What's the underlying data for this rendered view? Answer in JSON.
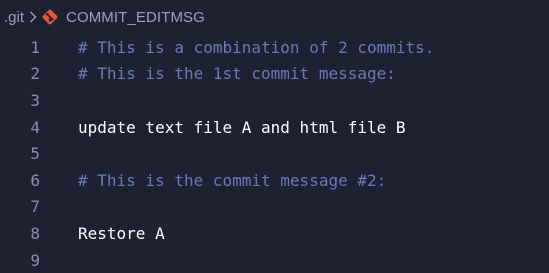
{
  "breadcrumb": {
    "folder": ".git",
    "separator_icon": "chevron-right-icon",
    "file_icon": "git-icon",
    "file": "COMMIT_EDITMSG"
  },
  "colors": {
    "background": "#1e2132",
    "comment": "#6b79b8",
    "text": "#ffffff",
    "line_number": "#8a8fa6",
    "git_icon": "#e8553a"
  },
  "editor": {
    "lines": [
      {
        "number": "1",
        "text": "# This is a combination of 2 commits.",
        "comment": true
      },
      {
        "number": "2",
        "text": "# This is the 1st commit message:",
        "comment": true
      },
      {
        "number": "3",
        "text": "",
        "comment": false
      },
      {
        "number": "4",
        "text": "update text file A and html file B",
        "comment": false
      },
      {
        "number": "5",
        "text": "",
        "comment": false
      },
      {
        "number": "6",
        "text": "# This is the commit message #2:",
        "comment": true
      },
      {
        "number": "7",
        "text": "",
        "comment": false
      },
      {
        "number": "8",
        "text": "Restore A",
        "comment": false
      },
      {
        "number": "9",
        "text": "",
        "comment": false
      }
    ]
  }
}
